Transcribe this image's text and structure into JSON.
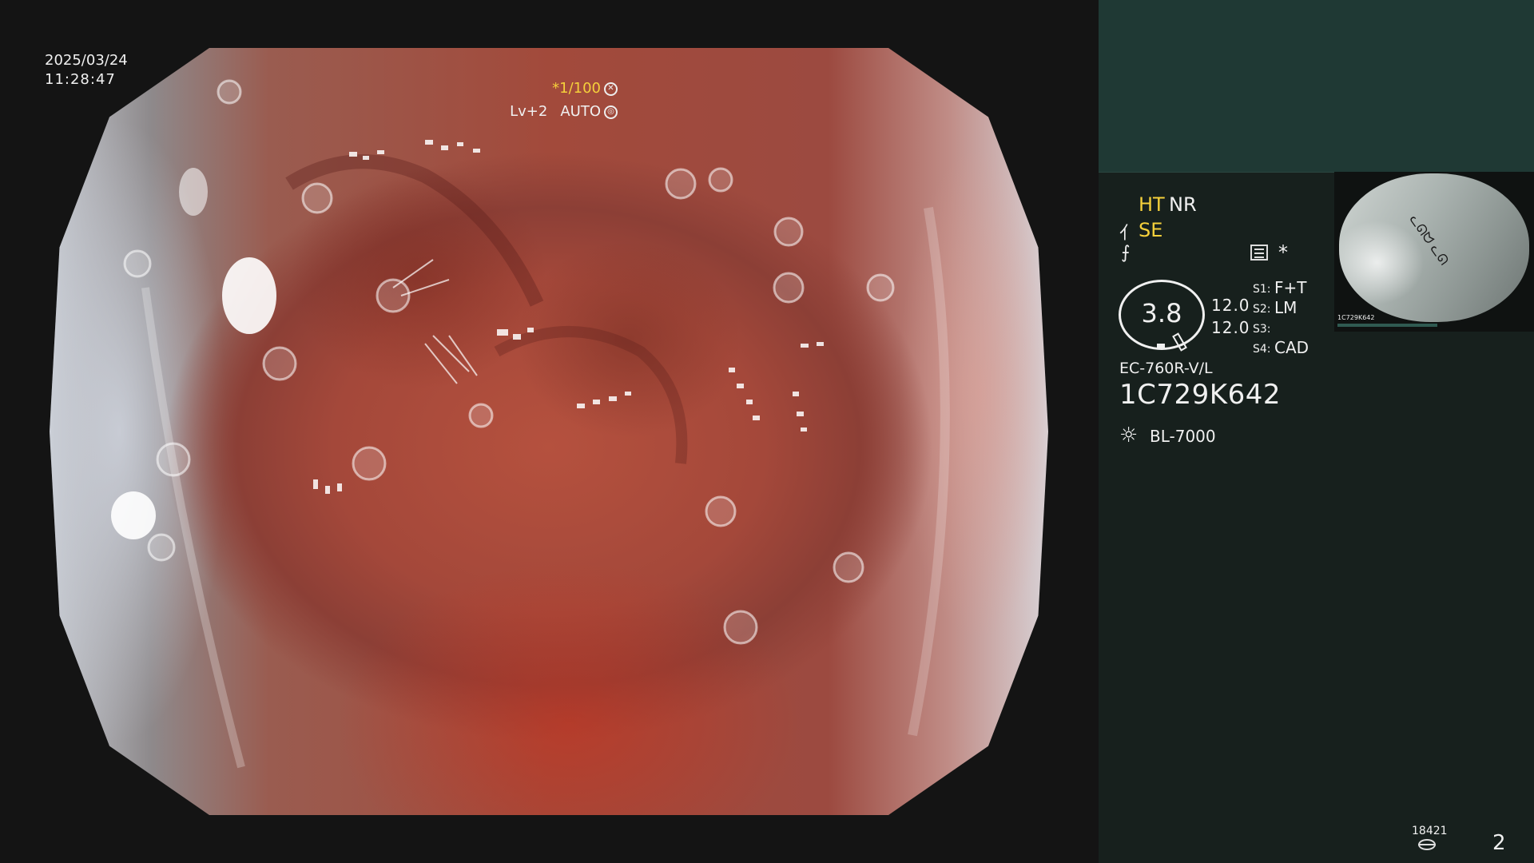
{
  "overlay": {
    "date": "2025/03/24",
    "time": "11:28:47",
    "shutter": "*1/100",
    "shutter_icon": "aperture-icon",
    "level": "Lv+2",
    "auto": "AUTO",
    "auto_icon": "iris-auto-icon"
  },
  "panel": {
    "ht": "HT",
    "nr": "NR",
    "se_icon": "⺅",
    "se": "SE",
    "enhance_icon": "⨍",
    "star": "*",
    "zoom": "3.8",
    "iris_a": "12.0",
    "iris_b": "12.0",
    "s1_key": "S1:",
    "s1_val": "F+T",
    "s2_key": "S2:",
    "s2_val": "LM",
    "s3_key": "S3:",
    "s3_val": "",
    "s4_key": "S4:",
    "s4_val": "CAD",
    "scope_model": "EC-760R-V/L",
    "scope_serial": "1C729K642",
    "sun_icon": "☼",
    "light_source": "BL-7000",
    "thumb_serial": "1C729K642",
    "counter": "18421",
    "page": "2"
  },
  "colors": {
    "accent_yellow": "#f5d03b",
    "panel_bg": "#17201d",
    "panel_header_bg": "#1f3934",
    "tissue": "#a4483a"
  }
}
